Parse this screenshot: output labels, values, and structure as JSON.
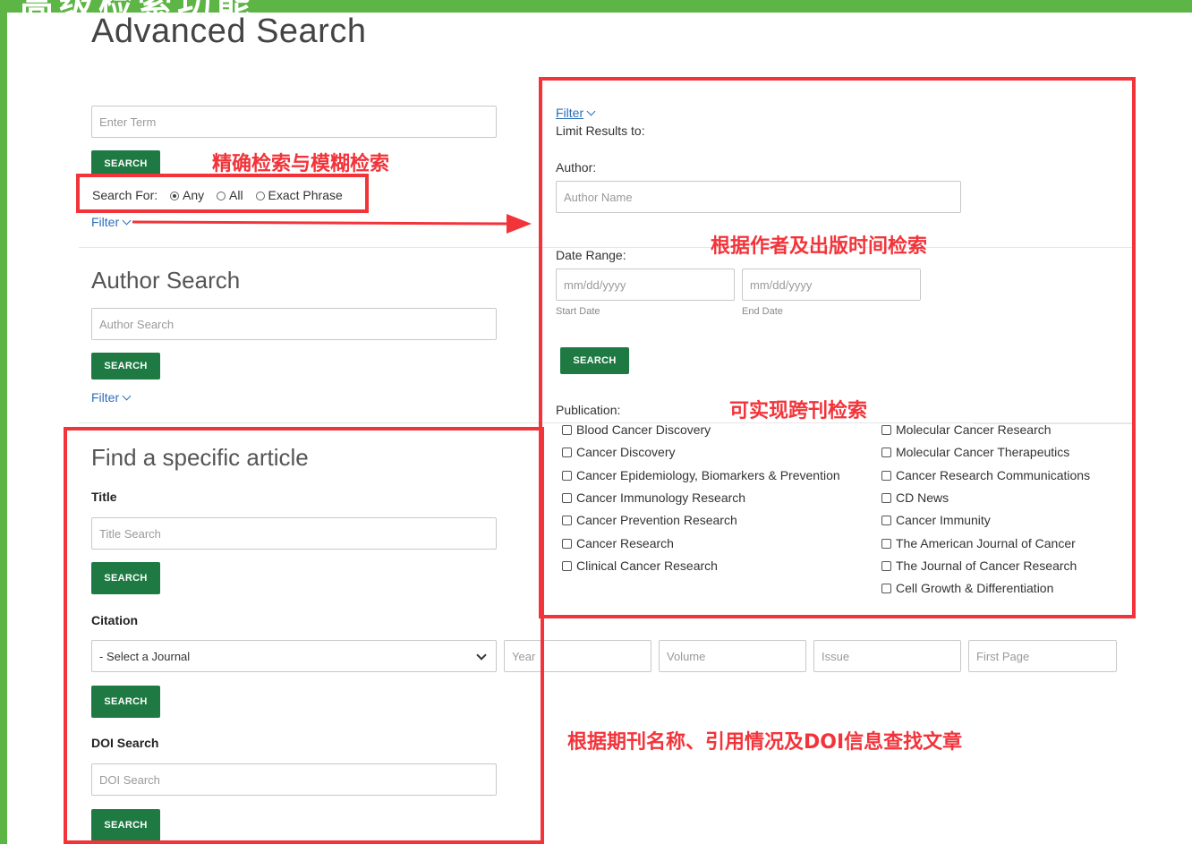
{
  "banner": {
    "title": "高级检索功能"
  },
  "header": {
    "title": "Advanced Search"
  },
  "basic": {
    "term_placeholder": "Enter Term",
    "search_label": "SEARCH",
    "search_for_label": "Search For:",
    "options": [
      "Any",
      "All",
      "Exact Phrase"
    ],
    "selected": "Any",
    "filter_label": "Filter"
  },
  "author_section": {
    "title": "Author Search",
    "placeholder": "Author Search",
    "search_label": "SEARCH",
    "filter_label": "Filter"
  },
  "article_section": {
    "title": "Find a specific article",
    "title_label": "Title",
    "title_placeholder": "Title Search",
    "search_label": "SEARCH",
    "citation_label": "Citation",
    "journal_select": "- Select a Journal",
    "year_placeholder": "Year",
    "volume_placeholder": "Volume",
    "issue_placeholder": "Issue",
    "first_page_placeholder": "First Page",
    "doi_label": "DOI Search",
    "doi_placeholder": "DOI Search"
  },
  "filter_panel": {
    "filter_label": "Filter",
    "limit_label": "Limit Results to:",
    "author_label": "Author:",
    "author_placeholder": "Author Name",
    "date_label": "Date Range:",
    "start_placeholder": "mm/dd/yyyy",
    "end_placeholder": "mm/dd/yyyy",
    "start_label": "Start Date",
    "end_label": "End Date",
    "search_label": "SEARCH",
    "publication_label": "Publication:",
    "publications_left": [
      "Blood Cancer Discovery",
      "Cancer Discovery",
      "Cancer Epidemiology, Biomarkers & Prevention",
      "Cancer Immunology Research",
      "Cancer Prevention Research",
      "Cancer Research",
      "Clinical Cancer Research"
    ],
    "publications_right": [
      "Molecular Cancer Research",
      "Molecular Cancer Therapeutics",
      "Cancer Research Communications",
      "CD News",
      "Cancer Immunity",
      "The American Journal of Cancer",
      "The Journal of Cancer Research",
      "Cell Growth & Differentiation"
    ]
  },
  "annotations": {
    "exact_fuzzy": "精确检索与模糊检索",
    "author_date": "根据作者及出版时间检索",
    "cross_journal": "可实现跨刊检索",
    "find_article": "根据期刊名称、引用情况及DOI信息查找文章"
  },
  "colors": {
    "accent_green": "#1e7a42",
    "annotation_red": "#f2343a",
    "background_green": "#5cb545",
    "link_blue": "#2a6ebb"
  }
}
